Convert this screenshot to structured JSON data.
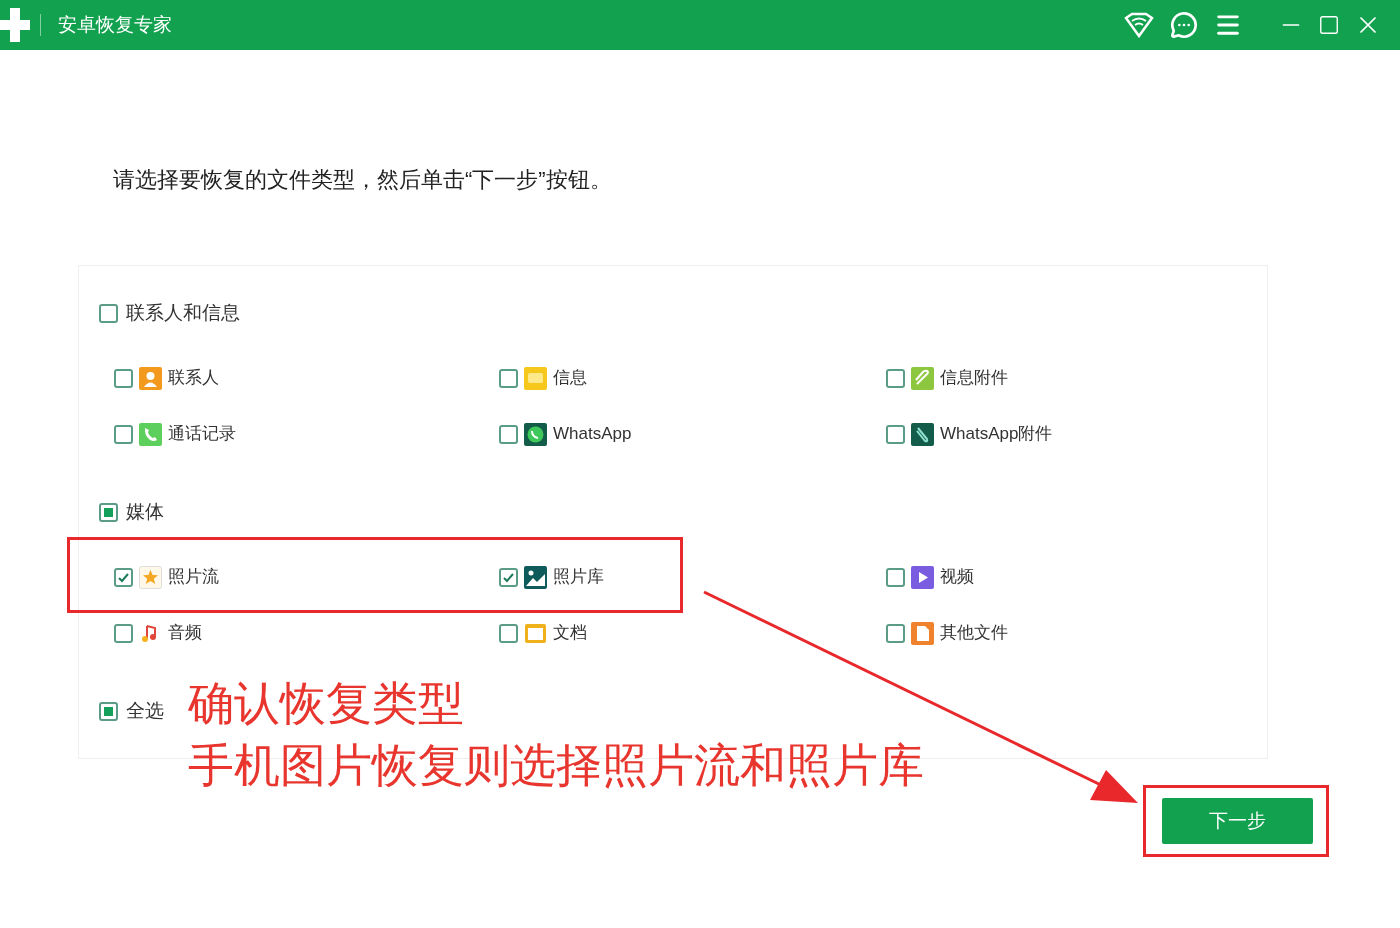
{
  "window": {
    "title": "安卓恢复专家"
  },
  "instruction": "请选择要恢复的文件类型，然后单击“下一步”按钮。",
  "groups": [
    {
      "label": "联系人和信息",
      "partial": false,
      "items": [
        {
          "label": "联系人",
          "kind": "contact",
          "checked": false
        },
        {
          "label": "信息",
          "kind": "message",
          "checked": false
        },
        {
          "label": "信息附件",
          "kind": "attachment",
          "checked": false
        },
        {
          "label": "通话记录",
          "kind": "call",
          "checked": false
        },
        {
          "label": "WhatsApp",
          "kind": "whatsapp",
          "checked": false
        },
        {
          "label": "WhatsApp附件",
          "kind": "whatsappattachment",
          "checked": false
        }
      ]
    },
    {
      "label": "媒体",
      "partial": true,
      "items": [
        {
          "label": "照片流",
          "kind": "photostream",
          "checked": true
        },
        {
          "label": "照片库",
          "kind": "gallery",
          "checked": true
        },
        {
          "label": "视频",
          "kind": "video",
          "checked": false
        },
        {
          "label": "音频",
          "kind": "audio",
          "checked": false
        },
        {
          "label": "文档",
          "kind": "document",
          "checked": false
        },
        {
          "label": "其他文件",
          "kind": "other",
          "checked": false
        }
      ]
    }
  ],
  "select_all": {
    "label": "全选",
    "partial": true
  },
  "annotation": {
    "lines": [
      "确认恢复类型",
      "手机图片恢复则选择照片流和照片库"
    ]
  },
  "next_button": "下一步"
}
